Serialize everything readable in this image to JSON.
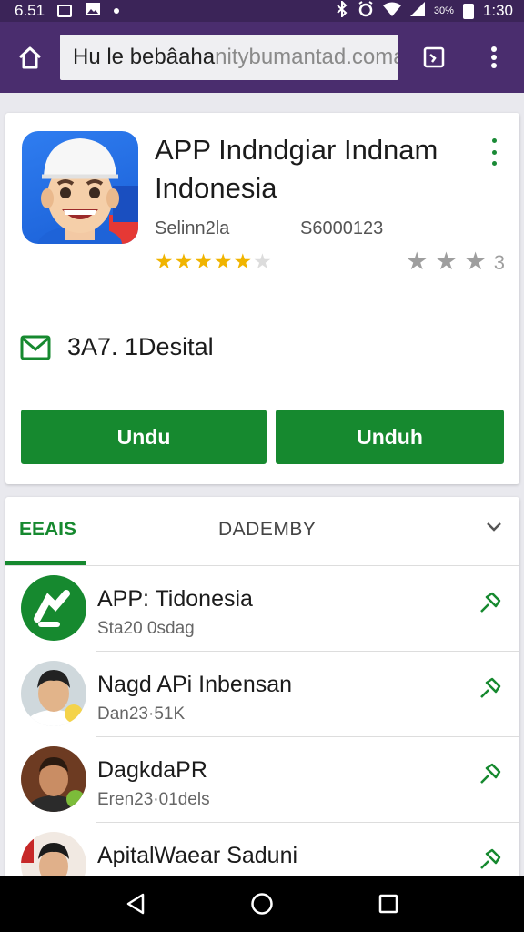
{
  "status_bar": {
    "time_left": "6.51",
    "battery_pct": "30%",
    "time_right": "1:30"
  },
  "toolbar": {
    "url_prefix": "Hu le bebâaha",
    "url_suffix": "nitybumantad.comall"
  },
  "app": {
    "title": "APP Indndgiar Indnam Indonesia",
    "developer": "Selinn2la",
    "downloads": "S6000123",
    "rating_stars": 4.5,
    "rating_secondary": "3",
    "info_text": "3A7. 1Desital",
    "button_left": "Undu",
    "button_right": "Unduh"
  },
  "tabs": {
    "active": "EEAIS",
    "second": "DADEMBY"
  },
  "list": [
    {
      "title": "APP: Tidonesia",
      "subtitle": "Sta20 0sdag"
    },
    {
      "title": "Nagd APi Inbensan",
      "subtitle": "Dan23·51K"
    },
    {
      "title": "DagkdaPR",
      "subtitle": "Eren23·01dels"
    },
    {
      "title": "ApitalWaear Saduni",
      "subtitle": ""
    }
  ],
  "colors": {
    "brand_green": "#16892f",
    "toolbar_purple": "#4a2d6e",
    "status_purple": "#3b2458",
    "star_gold": "#f0b400"
  }
}
